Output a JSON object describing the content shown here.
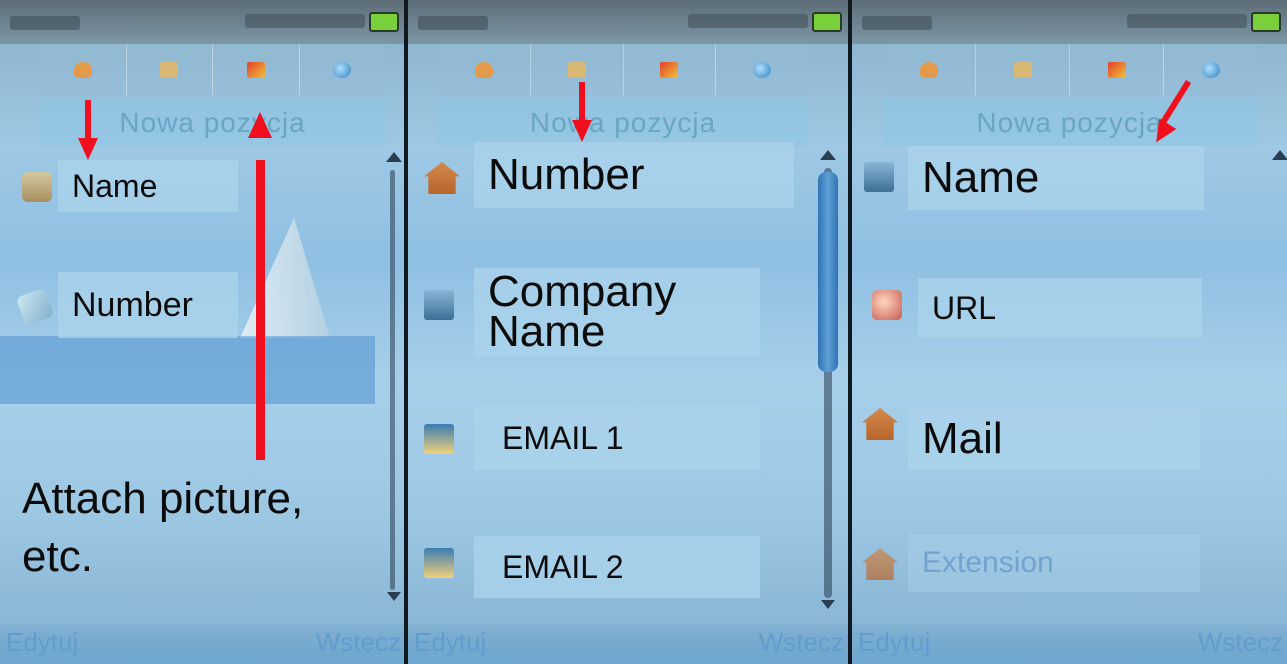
{
  "panels": [
    {
      "header_title": "Nowa pozycja",
      "fields": [
        "Name",
        "Number"
      ],
      "annotation": "Attach picture,\netc.",
      "softkeys": {
        "left": "Edytuj",
        "right": "Wstecz"
      }
    },
    {
      "header_title": "Nowa pozycja",
      "fields": [
        "Number",
        "Company\nName",
        "EMAIL 1",
        "EMAIL 2"
      ],
      "softkeys": {
        "left": "Edytuj",
        "right": "Wstecz"
      }
    },
    {
      "header_title": "Nowa pozycja",
      "fields": [
        "Name",
        "URL",
        "Mail",
        "Extension"
      ],
      "softkeys": {
        "left": "Edytuj",
        "right": "Wstecz"
      }
    }
  ],
  "tabs": [
    "contact-icon",
    "card-icon",
    "flag-icon",
    "globe-icon"
  ],
  "colors": {
    "arrow": "#ef0f1f",
    "field_bg": "#aad2eb",
    "accent": "#2f73b3"
  }
}
